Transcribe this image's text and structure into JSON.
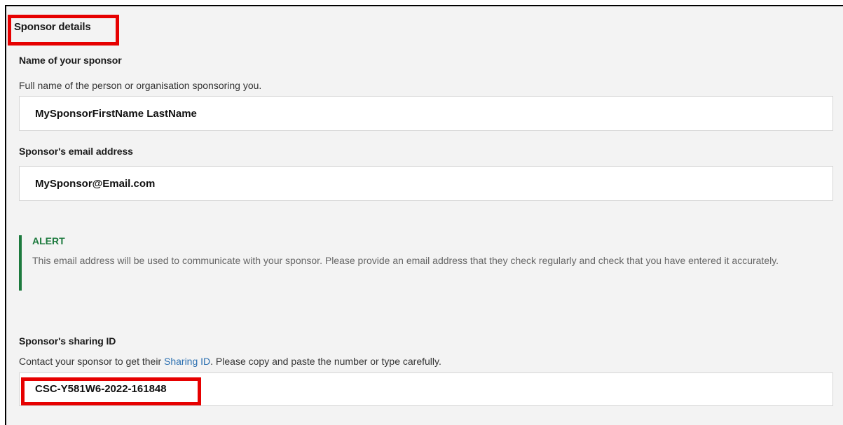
{
  "section": {
    "title": "Sponsor details"
  },
  "sponsor_name": {
    "label": "Name of your sponsor",
    "hint": "Full name of the person or organisation sponsoring you.",
    "value": "MySponsorFirstName LastName"
  },
  "sponsor_email": {
    "label": "Sponsor's email address",
    "value": "MySponsor@Email.com"
  },
  "alert": {
    "title": "ALERT",
    "body": "This email address will be used to communicate with your sponsor. Please provide an email address that they check regularly and check that you have entered it accurately."
  },
  "sharing_id": {
    "label": "Sponsor's sharing ID",
    "hint_prefix": "Contact your sponsor to get their ",
    "hint_link": "Sharing ID",
    "hint_suffix": ". Please copy and paste the number or type carefully.",
    "value": "CSC-Y581W6-2022-161848"
  },
  "colors": {
    "highlight": "#e60000",
    "alert_accent": "#1d7a3e",
    "link": "#2a6fb0",
    "panel_bg": "#f3f3f3"
  }
}
